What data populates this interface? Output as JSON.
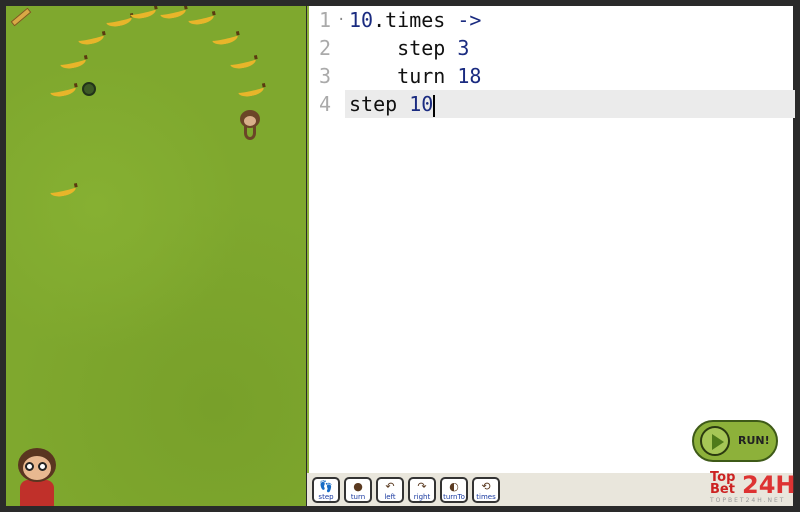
{
  "editor": {
    "lines": [
      {
        "no": "1",
        "fold": "·",
        "parts": [
          "10",
          ".times ",
          "->"
        ]
      },
      {
        "no": "2",
        "parts": [
          "    step ",
          "3"
        ]
      },
      {
        "no": "3",
        "parts": [
          "    turn ",
          "18"
        ]
      },
      {
        "no": "4",
        "parts": [
          "step ",
          "10"
        ]
      }
    ]
  },
  "run_button": {
    "label": "RUN!"
  },
  "toolbar": [
    {
      "label": "step",
      "icon": "footprints-icon"
    },
    {
      "label": "turn",
      "icon": "monkey-turn-icon"
    },
    {
      "label": "left",
      "icon": "arrow-left-icon"
    },
    {
      "label": "right",
      "icon": "arrow-right-icon"
    },
    {
      "label": "turnTo",
      "icon": "turn-to-icon"
    },
    {
      "label": "times",
      "icon": "loop-icon"
    }
  ],
  "watermark": {
    "top": "Top Bet",
    "big": "24H",
    "sub": "TOPBET24H.NET"
  },
  "colors": {
    "grass": "#7fa82e",
    "accent": "#8db13a",
    "number": "#1a2b80"
  }
}
